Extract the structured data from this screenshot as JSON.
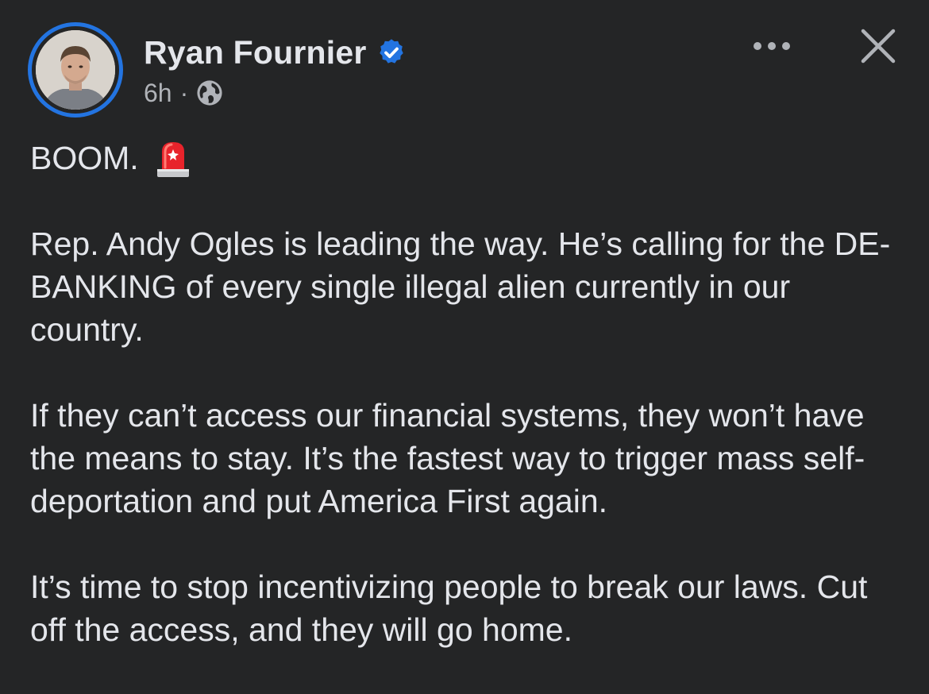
{
  "post": {
    "author": {
      "name": "Ryan Fournier",
      "verified_icon": "verified-badge-icon",
      "avatar_icon": "profile-photo"
    },
    "meta": {
      "time": "6h",
      "separator": "·",
      "audience_icon": "globe-icon"
    },
    "actions": {
      "more_icon": "more-horizontal-icon",
      "close_icon": "close-icon"
    },
    "paragraphs": [
      "BOOM.",
      "Rep. Andy Ogles is leading the way. He’s calling for the DE-BANKING of every single illegal alien currently in our country.",
      "If they can’t access our financial systems, they won’t have the means to stay. It’s the fastest way to trigger mass self-deportation and put America First again.",
      "It’s time to stop incentivizing people to break our laws. Cut off the access, and they will go home."
    ],
    "emoji_icon": "police-light-icon"
  },
  "colors": {
    "background": "#242526",
    "text_primary": "#e4e6eb",
    "text_secondary": "#b0b3b8",
    "accent_blue": "#2374e1",
    "siren_red": "#e8232b"
  }
}
